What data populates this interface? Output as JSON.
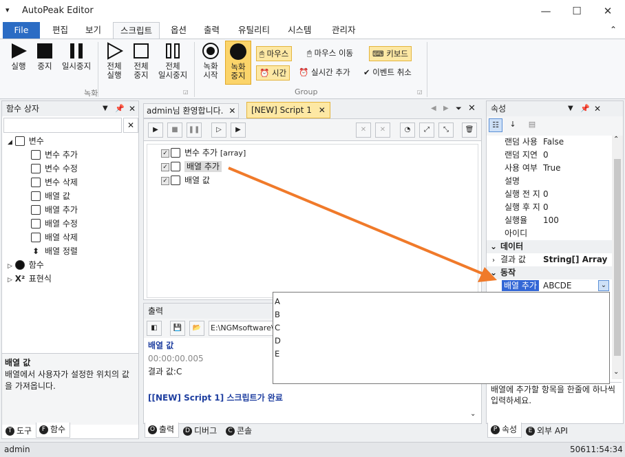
{
  "app": {
    "title": "AutoPeak Editor"
  },
  "menu": {
    "file": "File",
    "tabs": [
      "편집",
      "보기",
      "스크립트",
      "옵션",
      "출력",
      "유틸리티",
      "시스템",
      "관리자"
    ]
  },
  "ribbon": {
    "run": "실행",
    "stop": "중지",
    "pause": "일시중지",
    "run_all_1": "전체",
    "run_all_2": "실행",
    "stop_all_1": "전체",
    "stop_all_2": "중지",
    "pause_all_1": "전체",
    "pause_all_2": "일시중지",
    "rec_start_1": "녹화",
    "rec_start_2": "시작",
    "rec_stop_1": "녹화",
    "rec_stop_2": "중지",
    "group_record": "녹화",
    "group_group": "Group",
    "mouse": "마우스",
    "mouse_move": "마우스 이동",
    "keyboard": "키보드",
    "time": "시간",
    "realtime_add": "실시간 추가",
    "event_cancel": "이벤트 취소"
  },
  "toolbox": {
    "title": "함수 상자",
    "search_placeholder": "",
    "root_var": "변수",
    "items": [
      "변수 추가",
      "변수 수정",
      "변수 삭제",
      "배열 값",
      "배열 추가",
      "배열 수정",
      "배열 삭제",
      "배열 정렬"
    ],
    "root_func": "함수",
    "root_expr": "표현식",
    "desc_title": "배열 값",
    "desc_text": "배열에서 사용자가 설정한 위치의 값을 가져옵니다.",
    "tabs": [
      "도구",
      "함수"
    ]
  },
  "editor": {
    "tabs": [
      "admin님 환영합니다.",
      "[NEW] Script 1"
    ],
    "lines": [
      {
        "text": "변수 추가",
        "extra": "[array]"
      },
      {
        "text": "배열 추가",
        "extra": ""
      },
      {
        "text": "배열 값",
        "extra": ""
      }
    ]
  },
  "output": {
    "title": "출력",
    "path": "E:\\NGMsoftware\\",
    "lines": [
      "배열 값",
      "00:00:00.005",
      "결과 값:C",
      "",
      "[[NEW] Script 1] 스크립트가 완료"
    ],
    "tabs": [
      "출력",
      "디버그",
      "콘솔"
    ]
  },
  "props": {
    "title": "속성",
    "rows": [
      {
        "k": "랜덤 사용",
        "v": "False"
      },
      {
        "k": "랜덤 지연",
        "v": "0"
      },
      {
        "k": "사용 여부",
        "v": "True"
      },
      {
        "k": "설명",
        "v": ""
      },
      {
        "k": "실행 전 지",
        "v": "0"
      },
      {
        "k": "실행 후 지",
        "v": "0"
      },
      {
        "k": "실행율",
        "v": "100"
      },
      {
        "k": "아이디",
        "v": ""
      }
    ],
    "cat_data": "데이터",
    "result_key": "결과 값",
    "result_val": "String[] Array",
    "cat_action": "동작",
    "sel_key": "배열 추가",
    "sel_val": "ABCDE",
    "desc": "배열에 추가할 항목을 한줄에 하나씩 입력하세요.",
    "tabs": [
      "속성",
      "외부 API"
    ]
  },
  "dropdown": {
    "options": [
      "A",
      "B",
      "C",
      "D",
      "E"
    ]
  },
  "status": {
    "user": "admin",
    "time": "50611:54:34"
  }
}
